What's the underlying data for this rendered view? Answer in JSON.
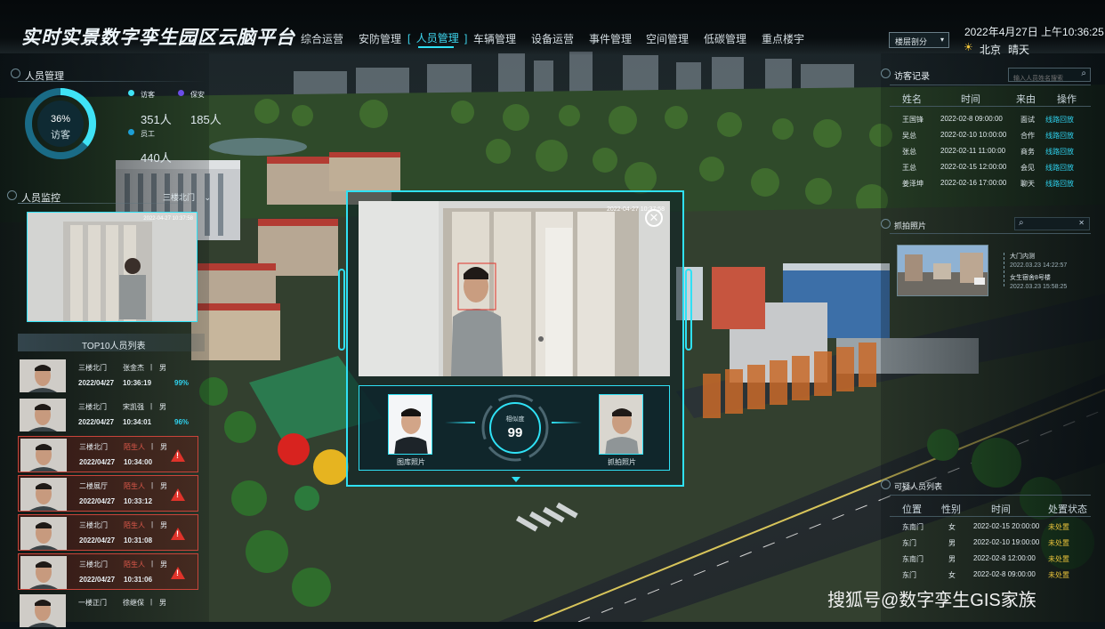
{
  "app": {
    "title": "实时实景数字孪生园区云脑平台"
  },
  "nav": [
    {
      "label": "综合运营"
    },
    {
      "label": "安防管理"
    },
    {
      "label": "人员管理",
      "active": true
    },
    {
      "label": "车辆管理"
    },
    {
      "label": "设备运营"
    },
    {
      "label": "事件管理"
    },
    {
      "label": "空间管理"
    },
    {
      "label": "低碳管理"
    },
    {
      "label": "重点楼宇"
    }
  ],
  "nav_brackets": {
    "open": "[",
    "close": "]"
  },
  "floor_select": {
    "value": "楼层剖分"
  },
  "datetime": "2022年4月27日 上午10:36:25",
  "weather": {
    "city": "北京",
    "condition": "晴天",
    "icon": "sun-icon"
  },
  "people_mgmt": {
    "title": "人员管理",
    "donut_percent": "36%",
    "donut_label": "访客",
    "donut_value": 36,
    "legend": [
      {
        "label": "访客",
        "value": "351人",
        "color": "#3fe3f6"
      },
      {
        "label": "保安",
        "value": "185人",
        "color": "#6b4de8"
      },
      {
        "label": "员工",
        "value": "440人",
        "color": "#1d9fd6"
      }
    ]
  },
  "monitor": {
    "title": "人员监控",
    "camera_select": "三楼北门",
    "video_timestamp": "2022-04-27 10:37:58"
  },
  "top10": {
    "title": "TOP10人员列表",
    "rows": [
      {
        "loc": "三楼北门",
        "name": "张金杰",
        "sep": "|",
        "gender": "男",
        "date": "2022/04/27",
        "time": "10:36:19",
        "pct": "99%",
        "stranger": false
      },
      {
        "loc": "三楼北门",
        "name": "宋凯强",
        "sep": "|",
        "gender": "男",
        "date": "2022/04/27",
        "time": "10:34:01",
        "pct": "96%",
        "stranger": false
      },
      {
        "loc": "三楼北门",
        "name": "陌生人",
        "sep": "|",
        "gender": "男",
        "date": "2022/04/27",
        "time": "10:34:00",
        "pct": "",
        "stranger": true
      },
      {
        "loc": "二楼展厅",
        "name": "陌生人",
        "sep": "|",
        "gender": "男",
        "date": "2022/04/27",
        "time": "10:33:12",
        "pct": "",
        "stranger": true
      },
      {
        "loc": "三楼北门",
        "name": "陌生人",
        "sep": "|",
        "gender": "男",
        "date": "2022/04/27",
        "time": "10:31:08",
        "pct": "",
        "stranger": true
      },
      {
        "loc": "三楼北门",
        "name": "陌生人",
        "sep": "|",
        "gender": "男",
        "date": "2022/04/27",
        "time": "10:31:06",
        "pct": "",
        "stranger": true
      },
      {
        "loc": "一楼正门",
        "name": "徐继保",
        "sep": "|",
        "gender": "男",
        "date": "",
        "time": "",
        "pct": "",
        "stranger": false
      }
    ]
  },
  "popup": {
    "timestamp": "2022-04-27 10:37:58",
    "similarity_label": "相似度",
    "similarity_value": "99",
    "db_photo_label": "图库照片",
    "capture_photo_label": "抓拍照片"
  },
  "visitor": {
    "title": "访客记录",
    "search_placeholder": "输入人员姓名搜索",
    "headers": [
      "姓名",
      "时间",
      "来由",
      "操作"
    ],
    "rows": [
      {
        "name": "王国锋",
        "time": "2022-02-8 09:00:00",
        "reason": "面试",
        "action": "线路回放"
      },
      {
        "name": "吴总",
        "time": "2022-02-10 10:00:00",
        "reason": "合作",
        "action": "线路回放"
      },
      {
        "name": "张总",
        "time": "2022-02-11 11:00:00",
        "reason": "商务",
        "action": "线路回放"
      },
      {
        "name": "王总",
        "time": "2022-02-15 12:00:00",
        "reason": "会见",
        "action": "线路回放"
      },
      {
        "name": "姜泽坤",
        "time": "2022-02-16 17:00:00",
        "reason": "聊天",
        "action": "线路回放"
      }
    ]
  },
  "capture": {
    "title": "抓拍照片",
    "items": [
      {
        "label": "大门内测",
        "time": "2022.03.23 14:22:57"
      },
      {
        "label": "女生宿舍8号楼",
        "time": "2022.03.23 15:58:25"
      }
    ]
  },
  "suspicious": {
    "title": "可疑人员列表",
    "headers": [
      "位置",
      "性别",
      "时间",
      "处置状态"
    ],
    "rows": [
      {
        "loc": "东南门",
        "gender": "女",
        "time": "2022-02-15 20:00:00",
        "status": "未处置"
      },
      {
        "loc": "东门",
        "gender": "男",
        "time": "2022-02-10 19:00:00",
        "status": "未处置"
      },
      {
        "loc": "东南门",
        "gender": "男",
        "time": "2022-02-8 12:00:00",
        "status": "未处置"
      },
      {
        "loc": "东门",
        "gender": "女",
        "time": "2022-02-8 09:00:00",
        "status": "未处置"
      }
    ]
  },
  "watermark": "搜狐号@数字孪生GIS家族",
  "colors": {
    "accent": "#2fe1f5",
    "warn": "#e8c23a",
    "danger": "#e0332a"
  }
}
